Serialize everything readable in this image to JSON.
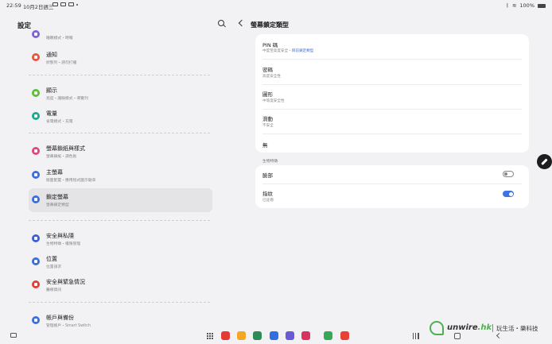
{
  "status_bar": {
    "time": "22:59",
    "date": "10月2日週三",
    "battery": "100%"
  },
  "left_panel": {
    "title": "設定",
    "items": [
      {
        "title": "",
        "subtitle": "睡眠模式・時報",
        "icon_color": "#7e63d6"
      },
      {
        "title": "通知",
        "subtitle": "狀態列・請勿打擾",
        "icon_color": "#e8563c"
      },
      {
        "title": "顯示",
        "subtitle": "亮度・護眼模式・導覽列",
        "icon_color": "#5cbf3a"
      },
      {
        "title": "電量",
        "subtitle": "省電模式・充電",
        "icon_color": "#1fa98e"
      },
      {
        "title": "螢幕鎖紙與樣式",
        "subtitle": "螢幕鎖紙・調色板",
        "icon_color": "#e0487a"
      },
      {
        "title": "主螢幕",
        "subtitle": "版面配置・應用程式圖示徽章",
        "icon_color": "#3b6fe0"
      },
      {
        "title": "鎖定螢幕",
        "subtitle": "螢幕鎖定類型",
        "icon_color": "#3b6fe0"
      },
      {
        "title": "安全與私隱",
        "subtitle": "生物特徵・權限管理",
        "icon_color": "#3a5fd8"
      },
      {
        "title": "位置",
        "subtitle": "位置請求",
        "icon_color": "#3a6fd8"
      },
      {
        "title": "安全與緊急情況",
        "subtitle": "醫療資訊",
        "icon_color": "#e0403a"
      },
      {
        "title": "帳戶與備份",
        "subtitle": "管理帳戶・Smart Switch",
        "icon_color": "#3b6fe0"
      }
    ]
  },
  "right_panel": {
    "title": "螢幕鎖定類型",
    "options": [
      {
        "title": "PIN 碼",
        "subtitle": "中度至高度安全・",
        "link": "目前鎖定類型"
      },
      {
        "title": "密碼",
        "subtitle": "高度安全性"
      },
      {
        "title": "圖形",
        "subtitle": "中等度安全性"
      },
      {
        "title": "滑動",
        "subtitle": "不安全"
      },
      {
        "title": "無",
        "subtitle": ""
      }
    ],
    "biometrics_label": "生物特徵",
    "biometrics": [
      {
        "title": "臉部",
        "subtitle": "",
        "enabled": false
      },
      {
        "title": "指紋",
        "subtitle": "已註冊",
        "enabled": true
      }
    ]
  },
  "dock": {
    "apps": [
      {
        "name": "app-1",
        "color": "#e53935"
      },
      {
        "name": "app-2",
        "color": "#f5a623"
      },
      {
        "name": "app-3",
        "color": "#2e8b57"
      },
      {
        "name": "app-4",
        "color": "#2f6fe0"
      },
      {
        "name": "app-5",
        "color": "#6a5ad6"
      },
      {
        "name": "app-6",
        "color": "#d8345f"
      },
      {
        "name": "app-7",
        "color": "#34a853"
      },
      {
        "name": "app-8",
        "color": "#e94235"
      }
    ]
  },
  "watermark": {
    "brand": "unwire",
    "brand_suffix": ".hk",
    "tagline": "玩生活・樂科技"
  },
  "colors": {
    "accent": "#3b74e8",
    "background": "#f2f2f4",
    "card": "#ffffff"
  }
}
